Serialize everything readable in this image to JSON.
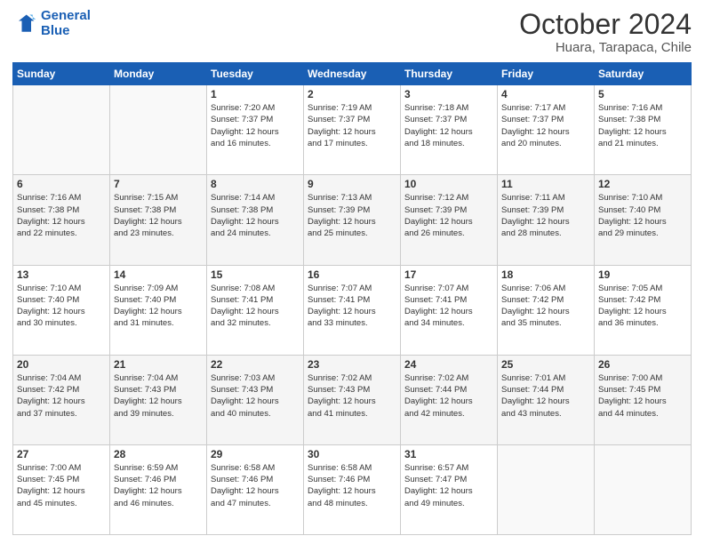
{
  "header": {
    "logo_line1": "General",
    "logo_line2": "Blue",
    "month": "October 2024",
    "location": "Huara, Tarapaca, Chile"
  },
  "weekdays": [
    "Sunday",
    "Monday",
    "Tuesday",
    "Wednesday",
    "Thursday",
    "Friday",
    "Saturday"
  ],
  "weeks": [
    [
      {
        "day": "",
        "info": ""
      },
      {
        "day": "",
        "info": ""
      },
      {
        "day": "1",
        "info": "Sunrise: 7:20 AM\nSunset: 7:37 PM\nDaylight: 12 hours\nand 16 minutes."
      },
      {
        "day": "2",
        "info": "Sunrise: 7:19 AM\nSunset: 7:37 PM\nDaylight: 12 hours\nand 17 minutes."
      },
      {
        "day": "3",
        "info": "Sunrise: 7:18 AM\nSunset: 7:37 PM\nDaylight: 12 hours\nand 18 minutes."
      },
      {
        "day": "4",
        "info": "Sunrise: 7:17 AM\nSunset: 7:37 PM\nDaylight: 12 hours\nand 20 minutes."
      },
      {
        "day": "5",
        "info": "Sunrise: 7:16 AM\nSunset: 7:38 PM\nDaylight: 12 hours\nand 21 minutes."
      }
    ],
    [
      {
        "day": "6",
        "info": "Sunrise: 7:16 AM\nSunset: 7:38 PM\nDaylight: 12 hours\nand 22 minutes."
      },
      {
        "day": "7",
        "info": "Sunrise: 7:15 AM\nSunset: 7:38 PM\nDaylight: 12 hours\nand 23 minutes."
      },
      {
        "day": "8",
        "info": "Sunrise: 7:14 AM\nSunset: 7:38 PM\nDaylight: 12 hours\nand 24 minutes."
      },
      {
        "day": "9",
        "info": "Sunrise: 7:13 AM\nSunset: 7:39 PM\nDaylight: 12 hours\nand 25 minutes."
      },
      {
        "day": "10",
        "info": "Sunrise: 7:12 AM\nSunset: 7:39 PM\nDaylight: 12 hours\nand 26 minutes."
      },
      {
        "day": "11",
        "info": "Sunrise: 7:11 AM\nSunset: 7:39 PM\nDaylight: 12 hours\nand 28 minutes."
      },
      {
        "day": "12",
        "info": "Sunrise: 7:10 AM\nSunset: 7:40 PM\nDaylight: 12 hours\nand 29 minutes."
      }
    ],
    [
      {
        "day": "13",
        "info": "Sunrise: 7:10 AM\nSunset: 7:40 PM\nDaylight: 12 hours\nand 30 minutes."
      },
      {
        "day": "14",
        "info": "Sunrise: 7:09 AM\nSunset: 7:40 PM\nDaylight: 12 hours\nand 31 minutes."
      },
      {
        "day": "15",
        "info": "Sunrise: 7:08 AM\nSunset: 7:41 PM\nDaylight: 12 hours\nand 32 minutes."
      },
      {
        "day": "16",
        "info": "Sunrise: 7:07 AM\nSunset: 7:41 PM\nDaylight: 12 hours\nand 33 minutes."
      },
      {
        "day": "17",
        "info": "Sunrise: 7:07 AM\nSunset: 7:41 PM\nDaylight: 12 hours\nand 34 minutes."
      },
      {
        "day": "18",
        "info": "Sunrise: 7:06 AM\nSunset: 7:42 PM\nDaylight: 12 hours\nand 35 minutes."
      },
      {
        "day": "19",
        "info": "Sunrise: 7:05 AM\nSunset: 7:42 PM\nDaylight: 12 hours\nand 36 minutes."
      }
    ],
    [
      {
        "day": "20",
        "info": "Sunrise: 7:04 AM\nSunset: 7:42 PM\nDaylight: 12 hours\nand 37 minutes."
      },
      {
        "day": "21",
        "info": "Sunrise: 7:04 AM\nSunset: 7:43 PM\nDaylight: 12 hours\nand 39 minutes."
      },
      {
        "day": "22",
        "info": "Sunrise: 7:03 AM\nSunset: 7:43 PM\nDaylight: 12 hours\nand 40 minutes."
      },
      {
        "day": "23",
        "info": "Sunrise: 7:02 AM\nSunset: 7:43 PM\nDaylight: 12 hours\nand 41 minutes."
      },
      {
        "day": "24",
        "info": "Sunrise: 7:02 AM\nSunset: 7:44 PM\nDaylight: 12 hours\nand 42 minutes."
      },
      {
        "day": "25",
        "info": "Sunrise: 7:01 AM\nSunset: 7:44 PM\nDaylight: 12 hours\nand 43 minutes."
      },
      {
        "day": "26",
        "info": "Sunrise: 7:00 AM\nSunset: 7:45 PM\nDaylight: 12 hours\nand 44 minutes."
      }
    ],
    [
      {
        "day": "27",
        "info": "Sunrise: 7:00 AM\nSunset: 7:45 PM\nDaylight: 12 hours\nand 45 minutes."
      },
      {
        "day": "28",
        "info": "Sunrise: 6:59 AM\nSunset: 7:46 PM\nDaylight: 12 hours\nand 46 minutes."
      },
      {
        "day": "29",
        "info": "Sunrise: 6:58 AM\nSunset: 7:46 PM\nDaylight: 12 hours\nand 47 minutes."
      },
      {
        "day": "30",
        "info": "Sunrise: 6:58 AM\nSunset: 7:46 PM\nDaylight: 12 hours\nand 48 minutes."
      },
      {
        "day": "31",
        "info": "Sunrise: 6:57 AM\nSunset: 7:47 PM\nDaylight: 12 hours\nand 49 minutes."
      },
      {
        "day": "",
        "info": ""
      },
      {
        "day": "",
        "info": ""
      }
    ]
  ]
}
